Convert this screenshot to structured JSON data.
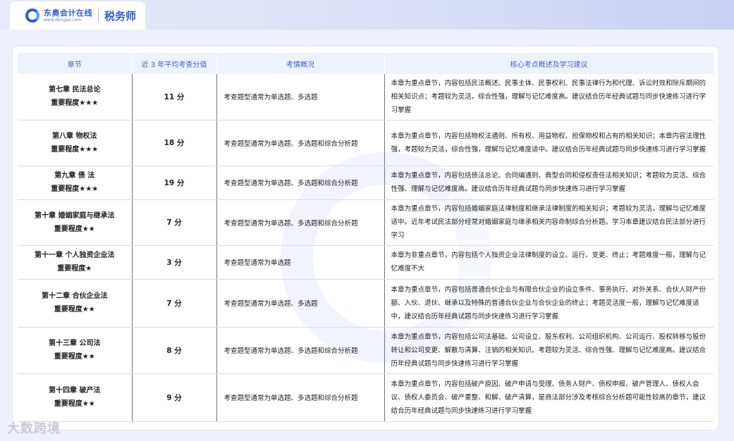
{
  "brand": {
    "logo_cn": "东奥会计在线",
    "logo_url": "www.dongao.com",
    "product": "税务师"
  },
  "table": {
    "headers": [
      "章节",
      "近 3 年平均考查分值",
      "考情概况",
      "核心考点概述及学习建议"
    ],
    "rows": [
      {
        "chapter": "第七章  民法总论",
        "importance": "重要程度★★★",
        "score": "11 分",
        "condition": "考查题型通常为单选题、多选题",
        "core": "本章为重点章节，内容包括民法概述、民事主体、民事权利、民事法律行为和代理、诉讼时效和除斥期间的相关知识点；考题较为灵活，综合性强，理解与记忆难度高。建议结合历年经典试题与同步快速练习进行学习掌握"
      },
      {
        "chapter": "第八章  物权法",
        "importance": "重要程度★★★",
        "score": "18 分",
        "condition": "考查题型通常为单选题、多选题和综合分析题",
        "core": "本章为重点章节，内容包括物权法通则、所有权、用益物权、担保物权和占有的相关知识；本章内容法理性强，考题较为灵活，综合性强，理解与记忆难度适中。建议结合历年经典试题与同步快速练习进行学习掌握"
      },
      {
        "chapter": "第九章  债  法",
        "importance": "重要程度★★★",
        "score": "19 分",
        "condition": "考查题型通常为单选题、多选题和综合分析题",
        "core": "本章为重点章节，内容包括债法总论、合同编通则、典型合同和侵权责任法相关知识；考题较为灵活、综合性强、理解与记忆难度高。建议结合历年经典试题与同步快速练习进行学习掌握"
      },
      {
        "chapter": "第十章  婚姻家庭与继承法",
        "importance": "重要程度★★",
        "score": "7 分",
        "condition": "考查题型通常为单选题、多选题和综合分析题",
        "core": "本章为重点章节，内容包括婚姻家庭法律制度和继承法律制度的相关知识；考题较为灵活，理解与记忆难度适中。近年考试民法部分经常对婚姻家庭与继承相关内容命制综合分析题。学习本章建议结合民法部分进行学习"
      },
      {
        "chapter": "第十一章  个人独资企业法",
        "importance": "重要程度★",
        "score": "3 分",
        "condition": "考查题型通常为单选题",
        "core": "本章为非重点章节，内容包括个人独资企业法律制度的设立、运行、变更、终止；考题难度一般，理解与记忆难度不大"
      },
      {
        "chapter": "第十二章  合伙企业法",
        "importance": "重要程度★★",
        "score": "7 分",
        "condition": "考查题型通常为单选题、多选题",
        "core": "本章为重点章节，内容包括普通合伙企业与有限合伙企业的设立条件、事务执行、对外关系、合伙人财产份额、入伙、退伙、继承以及特殊的普通合伙企业与合伙企业的终止；考题灵活度一般，理解与记忆难度适中，建议结合历年经典试题与同步快速练习进行学习掌握"
      },
      {
        "chapter": "第十三章  公司法",
        "importance": "重要程度★★",
        "score": "8 分",
        "condition": "考查题型通常为单选题、多选题和综合分析题",
        "core": "本章为重点章节，内容包括公司法基础、公司设立、股东权利、公司组织机构、公司运行、股权转移与股份转让和公司变更、解散与清算、注销的相关知识。考题较为灵活、综合性强、理解与记忆难度高。建议结合历年经典试题与同步快速练习进行学习掌握"
      },
      {
        "chapter": "第十四章  破产法",
        "importance": "重要程度★★",
        "score": "9 分",
        "condition": "考查题型通常为单选题、多选题和综合分析题",
        "core": "本章为重点章节，内容包括破产原因、破产申请与受理、债务人财产、债权申报、破产管理人、债权人会议、债权人委员会、破产重整、和解、破产清算，是商法部分涉及考核综合分析题可能性较高的章节，建议结合历年经典试题与同步快速练习进行学习掌握"
      }
    ]
  },
  "footer": {
    "watermark_text": "大数跨境"
  }
}
